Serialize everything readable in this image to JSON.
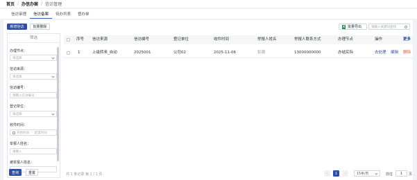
{
  "breadcrumb": {
    "home": "首页",
    "section": "办信办案",
    "current": "信访管理"
  },
  "tabs": [
    "信访审理",
    "信访备案",
    "待办列表",
    "督办单"
  ],
  "toolbar": {
    "new_label": "新增信访",
    "batch_delete_label": "批量删除",
    "export_label": "批量导出",
    "search_placeholder": "请输入关键词查找"
  },
  "filter": {
    "title": "筛选",
    "fields": [
      {
        "label": "办理节点：",
        "placeholder": "请选择"
      },
      {
        "label": "信访来源：",
        "placeholder": "请选择"
      },
      {
        "label": "信访编号：",
        "placeholder": "请输入信访编号"
      },
      {
        "label": "登记单位：",
        "placeholder": "请选择"
      },
      {
        "label": "收件时间：",
        "placeholder": "开始时间",
        "placeholder_end": "结束时间",
        "range_sep": "-"
      },
      {
        "label": "举报人姓名：",
        "placeholder": "请输入"
      },
      {
        "label": "被举报人姓名：",
        "placeholder": ""
      }
    ],
    "query_label": "查询",
    "reset_label": "重置"
  },
  "table": {
    "columns": [
      "序号",
      "信访来源",
      "信访编号",
      "登记单位",
      "收件时间",
      "举报人姓名",
      "举报人联系方式",
      "办理节点",
      "操作"
    ],
    "more_label": "更多",
    "rows": [
      {
        "index": "1",
        "source": "上级转来_自动",
        "number": "2025001",
        "unit": "公司02",
        "received": "2025-11-06",
        "reporter": "彭珊",
        "contact": "13000000000",
        "node": "办结实际",
        "actions": [
          "去处理",
          "编辑",
          "删除"
        ]
      }
    ]
  },
  "pagination": {
    "summary": "共 1 条记录 第 1 / 1 页",
    "current_page": "1",
    "prev": "‹",
    "next": "›",
    "page_size": "15条/页",
    "goto_label": "前往",
    "goto_value": "1",
    "page_suffix": "页"
  },
  "colors": {
    "primary": "#2f4f9e",
    "danger": "#e0533d",
    "link": "#2f4f9e"
  }
}
